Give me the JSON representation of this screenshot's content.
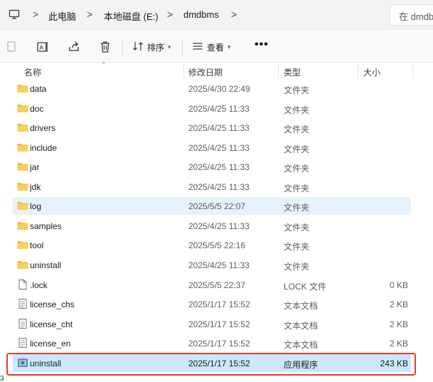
{
  "address_bar": {
    "crumbs": [
      "此电脑",
      "本地磁盘 (E:)",
      "dmdbms"
    ],
    "separator": ">",
    "search_placeholder": "在 dmdbms 中搜索"
  },
  "toolbar": {
    "sort_label": "排序",
    "view_label": "查看",
    "more_label": "•••",
    "icons": [
      "copy-icon",
      "rename-icon",
      "share-icon",
      "delete-icon",
      "sort-icon",
      "view-icon"
    ]
  },
  "columns": {
    "name": "名称",
    "date": "修改日期",
    "type": "类型",
    "size": "大小"
  },
  "files": [
    {
      "name": "data",
      "date": "2025/4/30 22:49",
      "type": "文件夹",
      "size": "",
      "icon": "folder-icon",
      "state": ""
    },
    {
      "name": "doc",
      "date": "2025/4/25 11:33",
      "type": "文件夹",
      "size": "",
      "icon": "folder-icon",
      "state": ""
    },
    {
      "name": "drivers",
      "date": "2025/4/25 11:33",
      "type": "文件夹",
      "size": "",
      "icon": "folder-icon",
      "state": ""
    },
    {
      "name": "include",
      "date": "2025/4/25 11:33",
      "type": "文件夹",
      "size": "",
      "icon": "folder-icon",
      "state": ""
    },
    {
      "name": "jar",
      "date": "2025/4/25 11:33",
      "type": "文件夹",
      "size": "",
      "icon": "folder-icon",
      "state": ""
    },
    {
      "name": "jdk",
      "date": "2025/4/25 11:33",
      "type": "文件夹",
      "size": "",
      "icon": "folder-icon",
      "state": ""
    },
    {
      "name": "log",
      "date": "2025/5/5 22:07",
      "type": "文件夹",
      "size": "",
      "icon": "folder-icon",
      "state": "hover"
    },
    {
      "name": "samples",
      "date": "2025/4/25 11:33",
      "type": "文件夹",
      "size": "",
      "icon": "folder-icon",
      "state": ""
    },
    {
      "name": "tool",
      "date": "2025/5/5 22:16",
      "type": "文件夹",
      "size": "",
      "icon": "folder-icon",
      "state": ""
    },
    {
      "name": "uninstall",
      "date": "2025/4/25 11:33",
      "type": "文件夹",
      "size": "",
      "icon": "folder-icon",
      "state": ""
    },
    {
      "name": ".lock",
      "date": "2025/5/5 22:37",
      "type": "LOCK 文件",
      "size": "0 KB",
      "icon": "file-icon",
      "state": ""
    },
    {
      "name": "license_chs",
      "date": "2025/1/17 15:52",
      "type": "文本文档",
      "size": "2 KB",
      "icon": "text-file-icon",
      "state": ""
    },
    {
      "name": "license_cht",
      "date": "2025/1/17 15:52",
      "type": "文本文档",
      "size": "2 KB",
      "icon": "text-file-icon",
      "state": ""
    },
    {
      "name": "license_en",
      "date": "2025/1/17 15:52",
      "type": "文本文档",
      "size": "2 KB",
      "icon": "text-file-icon",
      "state": ""
    },
    {
      "name": "uninstall",
      "date": "2025/1/17 15:52",
      "type": "应用程序",
      "size": "243 KB",
      "icon": "app-icon",
      "state": "selected"
    }
  ],
  "status": {
    "edge_text": "3"
  },
  "colors": {
    "folder": "#f5c242",
    "hover": "#e5f3fb",
    "selected": "#cce8ff",
    "highlight_border": "#e53935"
  }
}
